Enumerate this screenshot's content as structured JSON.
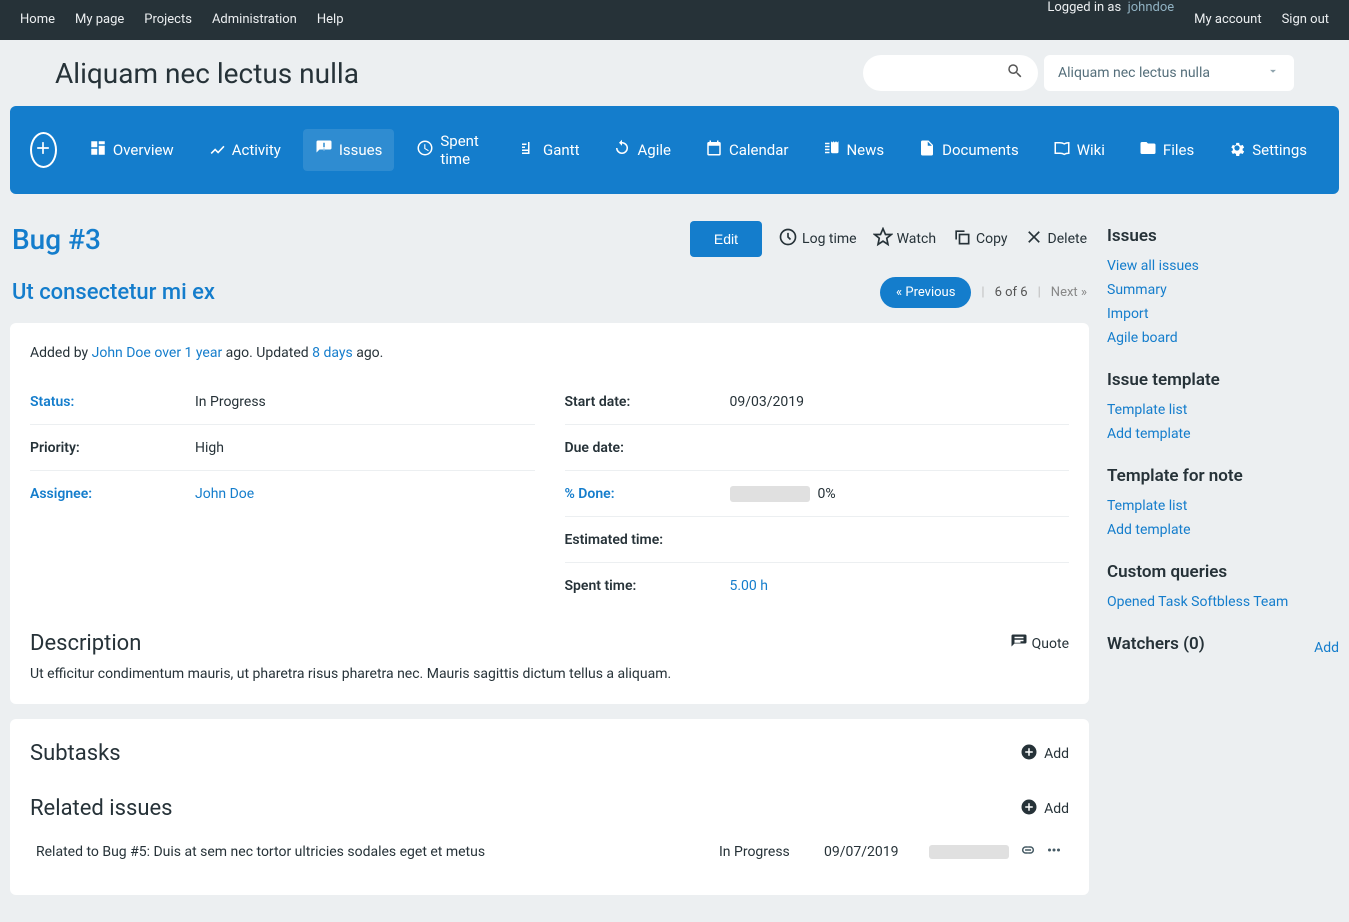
{
  "topbar": {
    "left": [
      "Home",
      "My page",
      "Projects",
      "Administration",
      "Help"
    ],
    "loggedInAs": "Logged in as",
    "username": "johndoe",
    "right": [
      "My account",
      "Sign out"
    ]
  },
  "header": {
    "projectTitle": "Aliquam nec lectus nulla",
    "projectSelector": "Aliquam nec lectus nulla"
  },
  "mainNav": {
    "overview": "Overview",
    "activity": "Activity",
    "issues": "Issues",
    "spentTime": "Spent time",
    "gantt": "Gantt",
    "agile": "Agile",
    "calendar": "Calendar",
    "news": "News",
    "documents": "Documents",
    "wiki": "Wiki",
    "files": "Files",
    "settings": "Settings"
  },
  "issue": {
    "id": "Bug #3",
    "actions": {
      "edit": "Edit",
      "logTime": "Log time",
      "watch": "Watch",
      "copy": "Copy",
      "delete": "Delete"
    },
    "subject": "Ut consectetur mi ex",
    "pagination": {
      "prev": "« Previous",
      "position": "6 of 6",
      "next": "Next »"
    },
    "addedBy": {
      "prefix": "Added by ",
      "author": "John Doe",
      "sep1": " ",
      "created": "over 1 year",
      "mid": " ago. Updated ",
      "updated": "8 days",
      "suffix": " ago."
    },
    "attrs": {
      "status": {
        "label": "Status:",
        "value": "In Progress"
      },
      "priority": {
        "label": "Priority:",
        "value": "High"
      },
      "assignee": {
        "label": "Assignee:",
        "value": "John Doe"
      },
      "startDate": {
        "label": "Start date:",
        "value": "09/03/2019"
      },
      "dueDate": {
        "label": "Due date:",
        "value": ""
      },
      "pctDone": {
        "label": "% Done:",
        "value": "0%"
      },
      "estTime": {
        "label": "Estimated time:",
        "value": ""
      },
      "spentTime": {
        "label": "Spent time:",
        "value": "5.00 h"
      }
    },
    "description": {
      "heading": "Description",
      "quote": "Quote",
      "text": "Ut efficitur condimentum mauris, ut pharetra risus pharetra nec. Mauris sagittis dictum tellus a aliquam."
    }
  },
  "subtasks": {
    "heading": "Subtasks",
    "add": "Add"
  },
  "related": {
    "heading": "Related issues",
    "add": "Add",
    "items": [
      {
        "title": "Related to Bug #5: Duis at sem nec tortor ultricies sodales eget et metus",
        "status": "In Progress",
        "date": "09/07/2019"
      }
    ]
  },
  "sidebar": {
    "issues": {
      "heading": "Issues",
      "links": [
        "View all issues",
        "Summary",
        "Import",
        "Agile board"
      ]
    },
    "template": {
      "heading": "Issue template",
      "links": [
        "Template list",
        "Add template"
      ]
    },
    "noteTemplate": {
      "heading": "Template for note",
      "links": [
        "Template list",
        "Add template"
      ]
    },
    "customQueries": {
      "heading": "Custom queries",
      "links": [
        "Opened Task Softbless Team"
      ]
    },
    "watchers": {
      "heading": "Watchers (0)",
      "add": "Add"
    }
  }
}
